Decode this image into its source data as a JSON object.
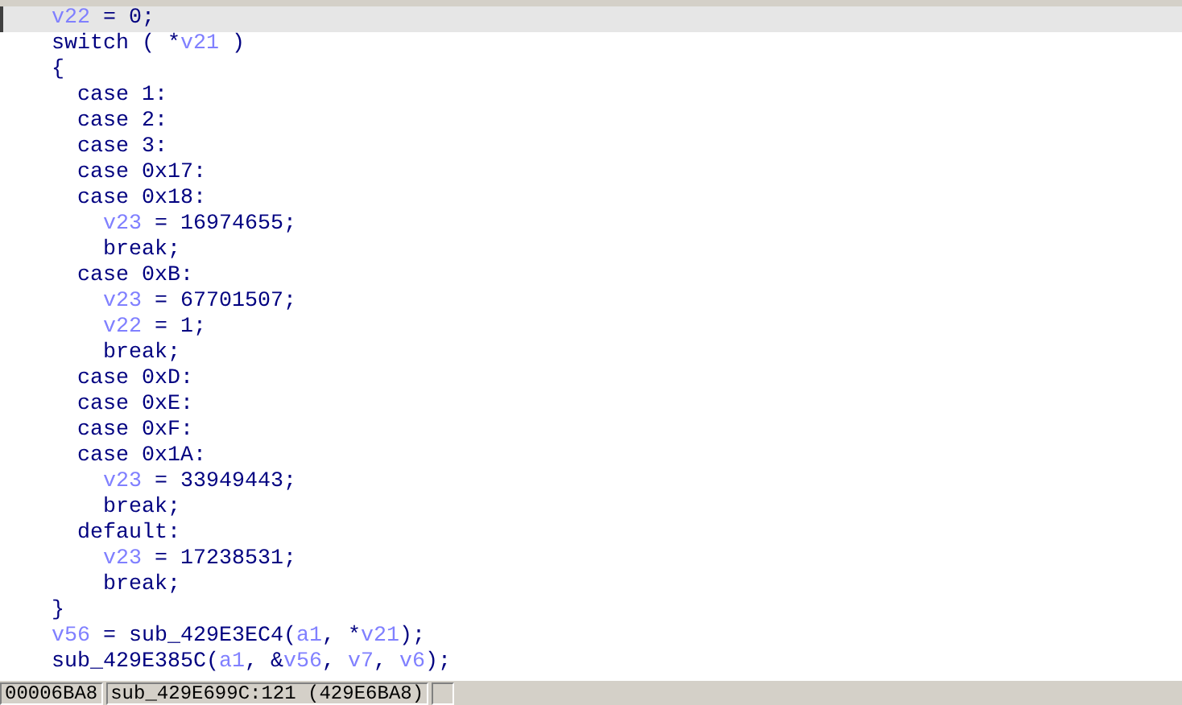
{
  "code_lines": [
    {
      "current": true,
      "segments": [
        {
          "kind": "var",
          "text": "    v22"
        },
        {
          "kind": "plain",
          "text": " = 0;"
        }
      ]
    },
    {
      "current": false,
      "segments": [
        {
          "kind": "plain",
          "text": "    switch ( *"
        },
        {
          "kind": "var",
          "text": "v21"
        },
        {
          "kind": "plain",
          "text": " )"
        }
      ]
    },
    {
      "current": false,
      "segments": [
        {
          "kind": "plain",
          "text": "    {"
        }
      ]
    },
    {
      "current": false,
      "segments": [
        {
          "kind": "plain",
          "text": "      case 1:"
        }
      ]
    },
    {
      "current": false,
      "segments": [
        {
          "kind": "plain",
          "text": "      case 2:"
        }
      ]
    },
    {
      "current": false,
      "segments": [
        {
          "kind": "plain",
          "text": "      case 3:"
        }
      ]
    },
    {
      "current": false,
      "segments": [
        {
          "kind": "plain",
          "text": "      case 0x17:"
        }
      ]
    },
    {
      "current": false,
      "segments": [
        {
          "kind": "plain",
          "text": "      case 0x18:"
        }
      ]
    },
    {
      "current": false,
      "segments": [
        {
          "kind": "var",
          "text": "        v23"
        },
        {
          "kind": "plain",
          "text": " = 16974655;"
        }
      ]
    },
    {
      "current": false,
      "segments": [
        {
          "kind": "plain",
          "text": "        break;"
        }
      ]
    },
    {
      "current": false,
      "segments": [
        {
          "kind": "plain",
          "text": "      case 0xB:"
        }
      ]
    },
    {
      "current": false,
      "segments": [
        {
          "kind": "var",
          "text": "        v23"
        },
        {
          "kind": "plain",
          "text": " = 67701507;"
        }
      ]
    },
    {
      "current": false,
      "segments": [
        {
          "kind": "var",
          "text": "        v22"
        },
        {
          "kind": "plain",
          "text": " = 1;"
        }
      ]
    },
    {
      "current": false,
      "segments": [
        {
          "kind": "plain",
          "text": "        break;"
        }
      ]
    },
    {
      "current": false,
      "segments": [
        {
          "kind": "plain",
          "text": "      case 0xD:"
        }
      ]
    },
    {
      "current": false,
      "segments": [
        {
          "kind": "plain",
          "text": "      case 0xE:"
        }
      ]
    },
    {
      "current": false,
      "segments": [
        {
          "kind": "plain",
          "text": "      case 0xF:"
        }
      ]
    },
    {
      "current": false,
      "segments": [
        {
          "kind": "plain",
          "text": "      case 0x1A:"
        }
      ]
    },
    {
      "current": false,
      "segments": [
        {
          "kind": "var",
          "text": "        v23"
        },
        {
          "kind": "plain",
          "text": " = 33949443;"
        }
      ]
    },
    {
      "current": false,
      "segments": [
        {
          "kind": "plain",
          "text": "        break;"
        }
      ]
    },
    {
      "current": false,
      "segments": [
        {
          "kind": "plain",
          "text": "      default:"
        }
      ]
    },
    {
      "current": false,
      "segments": [
        {
          "kind": "var",
          "text": "        v23"
        },
        {
          "kind": "plain",
          "text": " = 17238531;"
        }
      ]
    },
    {
      "current": false,
      "segments": [
        {
          "kind": "plain",
          "text": "        break;"
        }
      ]
    },
    {
      "current": false,
      "segments": [
        {
          "kind": "plain",
          "text": "    }"
        }
      ]
    },
    {
      "current": false,
      "segments": [
        {
          "kind": "var",
          "text": "    v56"
        },
        {
          "kind": "plain",
          "text": " = sub_429E3EC4("
        },
        {
          "kind": "var",
          "text": "a1"
        },
        {
          "kind": "plain",
          "text": ", *"
        },
        {
          "kind": "var",
          "text": "v21"
        },
        {
          "kind": "plain",
          "text": ");"
        }
      ]
    },
    {
      "current": false,
      "segments": [
        {
          "kind": "plain",
          "text": "    sub_429E385C("
        },
        {
          "kind": "var",
          "text": "a1"
        },
        {
          "kind": "plain",
          "text": ", &"
        },
        {
          "kind": "var",
          "text": "v56"
        },
        {
          "kind": "plain",
          "text": ", "
        },
        {
          "kind": "var",
          "text": "v7"
        },
        {
          "kind": "plain",
          "text": ", "
        },
        {
          "kind": "var",
          "text": "v6"
        },
        {
          "kind": "plain",
          "text": ");"
        }
      ]
    }
  ],
  "status_bar": [
    "00006BA8",
    "sub_429E699C:121 (429E6BA8)"
  ]
}
